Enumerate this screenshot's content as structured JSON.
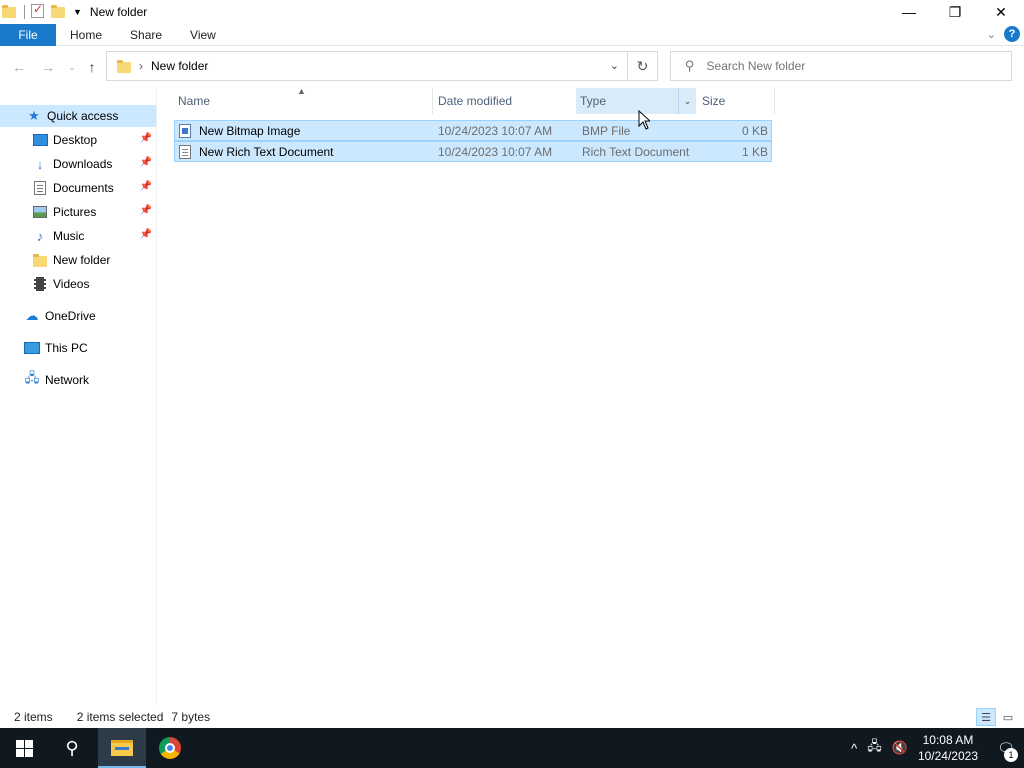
{
  "window": {
    "title": "New folder",
    "controls": {
      "minimize": "—",
      "maximize": "❐",
      "close": "✕"
    }
  },
  "ribbon": {
    "tabs": [
      "File",
      "Home",
      "Share",
      "View"
    ],
    "help": "?"
  },
  "nav": {
    "address_path": "New folder",
    "search_placeholder": "Search New folder"
  },
  "sidebar": {
    "quick_access": "Quick access",
    "items": [
      {
        "label": "Desktop",
        "pinned": true
      },
      {
        "label": "Downloads",
        "pinned": true
      },
      {
        "label": "Documents",
        "pinned": true
      },
      {
        "label": "Pictures",
        "pinned": true
      },
      {
        "label": "Music",
        "pinned": true
      },
      {
        "label": "New folder",
        "pinned": false
      },
      {
        "label": "Videos",
        "pinned": false
      }
    ],
    "onedrive": "OneDrive",
    "this_pc": "This PC",
    "network": "Network"
  },
  "filelist": {
    "columns": [
      "Name",
      "Date modified",
      "Type",
      "Size"
    ],
    "rows": [
      {
        "name": "New Bitmap Image",
        "date": "10/24/2023 10:07 AM",
        "type": "BMP File",
        "size": "0 KB",
        "selected": true
      },
      {
        "name": "New Rich Text Document",
        "date": "10/24/2023 10:07 AM",
        "type": "Rich Text Document",
        "size": "1 KB",
        "selected": true
      }
    ]
  },
  "status": {
    "item_count": "2 items",
    "selected": "2 items selected",
    "size": "7 bytes"
  },
  "taskbar": {
    "time": "10:08 AM",
    "date": "10/24/2023",
    "notifications": "1"
  },
  "colors": {
    "accent": "#1979ca",
    "selection": "#cce8ff",
    "selection_border": "#99d1ff",
    "taskbar": "#101820"
  }
}
